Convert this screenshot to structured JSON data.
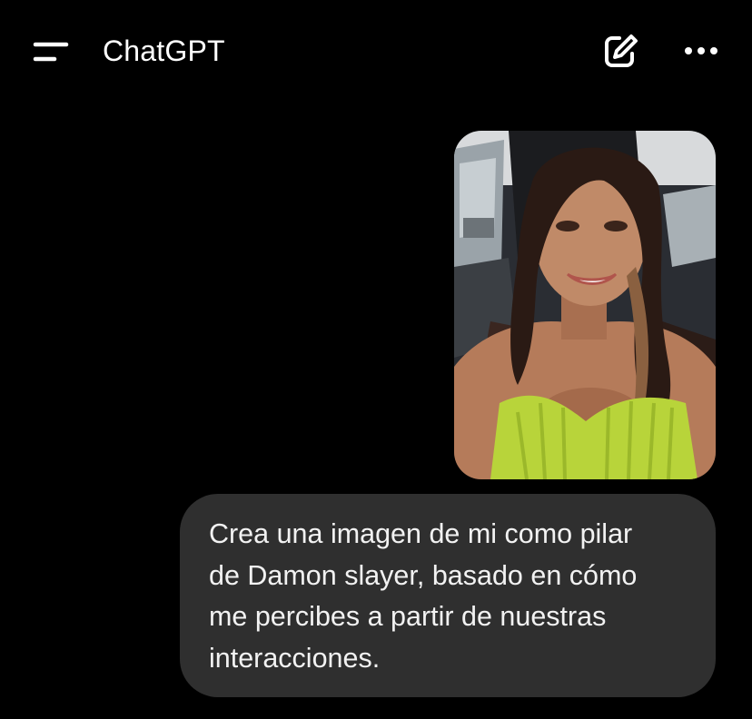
{
  "header": {
    "title": "ChatGPT",
    "menu_icon": "hamburger-menu-icon",
    "new_chat_icon": "edit-pencil-icon",
    "more_icon": "more-dots-icon"
  },
  "conversation": {
    "user_image": {
      "description_icon": "user-uploaded-photo"
    },
    "user_message": {
      "lines": [
        "Crea una imagen de mi como pilar",
        "de Damon slayer, basado en cómo",
        "me percibes a partir de nuestras",
        "interacciones."
      ]
    }
  },
  "colors": {
    "background": "#000000",
    "bubble": "#2f2f2f",
    "text": "#ffffff",
    "dress": "#b8d43a"
  }
}
